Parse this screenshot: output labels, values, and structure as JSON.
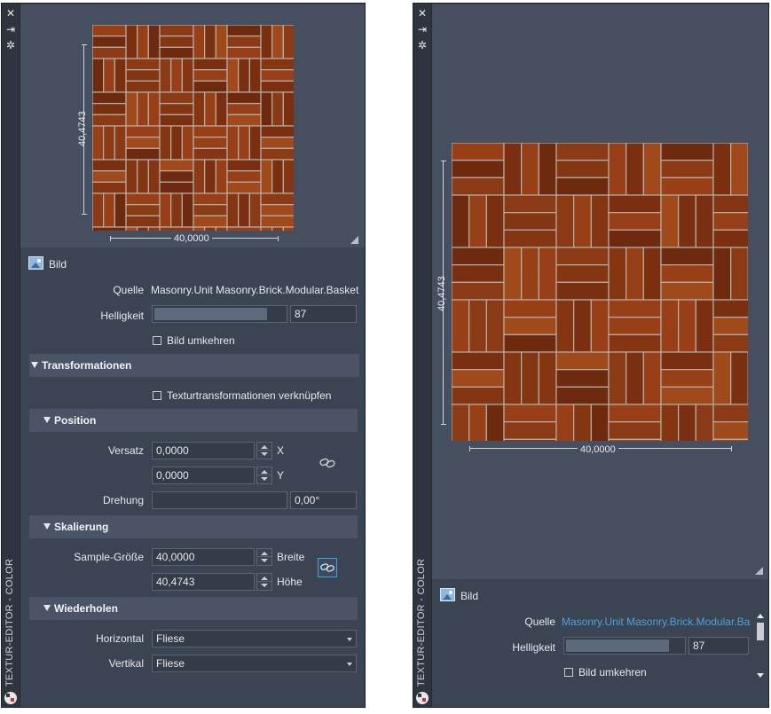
{
  "colors": {
    "panel_bg": "#3b4453",
    "strip_bg": "#2e3440",
    "section_bg": "#4a5466",
    "link_color": "#4aa3df",
    "brick": "#7a3312"
  },
  "strip": {
    "close_glyph": "✕",
    "pin_glyph": "⇥",
    "settings_glyph": "✲",
    "vertical_title": "TEXTUR-EDITOR - COLOR"
  },
  "left": {
    "preview": {
      "height_label": "40,4743",
      "width_label": "40,0000"
    },
    "bild": {
      "title": "Bild"
    },
    "quelle": {
      "label": "Quelle",
      "value": "Masonry.Unit Masonry.Brick.Modular.Basket"
    },
    "helligkeit": {
      "label": "Helligkeit",
      "value": "87",
      "fraction": 0.87
    },
    "bild_umkehren": {
      "label": "Bild umkehren",
      "checked": false
    },
    "transformationen": {
      "title": "Transformationen",
      "link_label": "Texturtransformationen verknüpfen",
      "link_checked": false
    },
    "position": {
      "title": "Position",
      "versatz_label": "Versatz",
      "x_value": "0,0000",
      "x_unit": "X",
      "y_value": "0,0000",
      "y_unit": "Y",
      "drehung_label": "Drehung",
      "drehung_value": "0,00°"
    },
    "skalierung": {
      "title": "Skalierung",
      "sample_label": "Sample-Größe",
      "breite_value": "40,0000",
      "breite_unit": "Breite",
      "hoehe_value": "40,4743",
      "hoehe_unit": "Höhe"
    },
    "wiederholen": {
      "title": "Wiederholen",
      "horizontal_label": "Horizontal",
      "horizontal_value": "Fliese",
      "vertikal_label": "Vertikal",
      "vertikal_value": "Fliese"
    }
  },
  "right": {
    "preview": {
      "height_label": "40,4743",
      "width_label": "40,0000"
    },
    "bild": {
      "title": "Bild"
    },
    "quelle": {
      "label": "Quelle",
      "value": "Masonry.Unit Masonry.Brick.Modular.Ba"
    },
    "helligkeit": {
      "label": "Helligkeit",
      "value": "87",
      "fraction": 0.87
    },
    "bild_umkehren": {
      "label": "Bild umkehren",
      "checked": false
    }
  }
}
